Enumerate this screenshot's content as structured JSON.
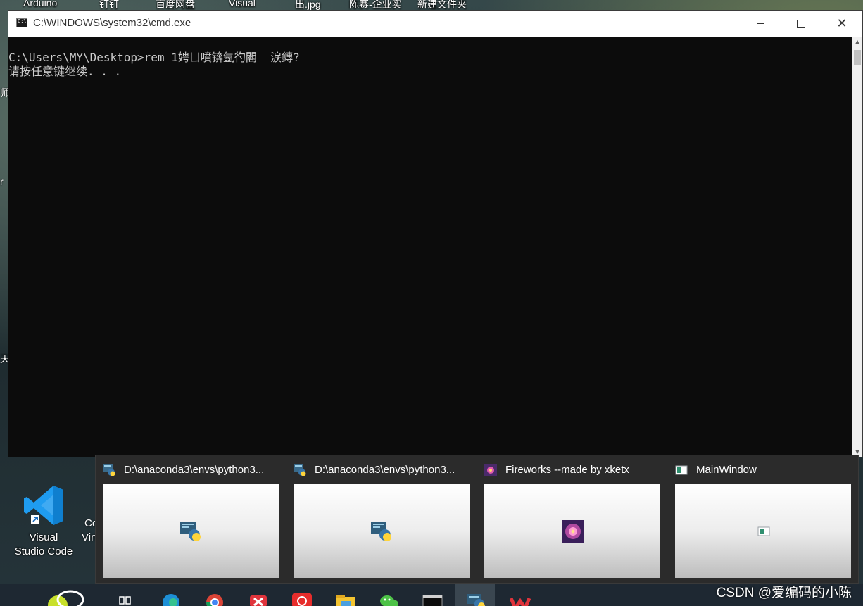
{
  "desktop": {
    "top_icon_labels": [
      "Arduino",
      "钉钉",
      "百度网盘",
      "Visual",
      "出.jpg",
      "陈赛-企业实",
      "新建文件夹"
    ],
    "left_edge_glyphs": [
      "师",
      "r",
      "天"
    ],
    "vscode_icon_label_line1": "Visual",
    "vscode_icon_label_line2": "Studio Code",
    "partial_icon_label_line1": "Co",
    "partial_icon_label_line2": "Virt"
  },
  "cmd": {
    "title": "C:\\WINDOWS\\system32\\cmd.exe",
    "minimize_icon": "minimize-icon",
    "maximize_icon": "maximize-icon",
    "close_icon": "close-icon",
    "lines": [
      "C:\\Users\\MY\\Desktop>rem 1娉ㄩ噴锛氬彴閣  涙鏄?",
      "请按任意键继续. . ."
    ]
  },
  "previews": [
    {
      "title": "D:\\anaconda3\\envs\\python3...",
      "icon": "python-icon"
    },
    {
      "title": "D:\\anaconda3\\envs\\python3...",
      "icon": "python-icon"
    },
    {
      "title": "Fireworks --made by xketx",
      "icon": "fireworks-icon"
    },
    {
      "title": "MainWindow",
      "icon": "window-icon"
    }
  ],
  "taskbar": {
    "icons": [
      "tennis-icon",
      "task-view-icon",
      "edge-icon",
      "chrome-icon",
      "xmind-icon",
      "netease-music-icon",
      "file-explorer-icon",
      "wechat-icon",
      "terminal-icon",
      "python-icon",
      "wps-icon"
    ],
    "watermark": "CSDN @爱编码的小陈"
  },
  "colors": {
    "cmd_bg": "#0c0c0c",
    "cmd_text": "#cccccc",
    "taskbar_bg": "#1e2832",
    "preview_bg": "#2b2b2b",
    "vscode_blue": "#1f9cf0"
  }
}
